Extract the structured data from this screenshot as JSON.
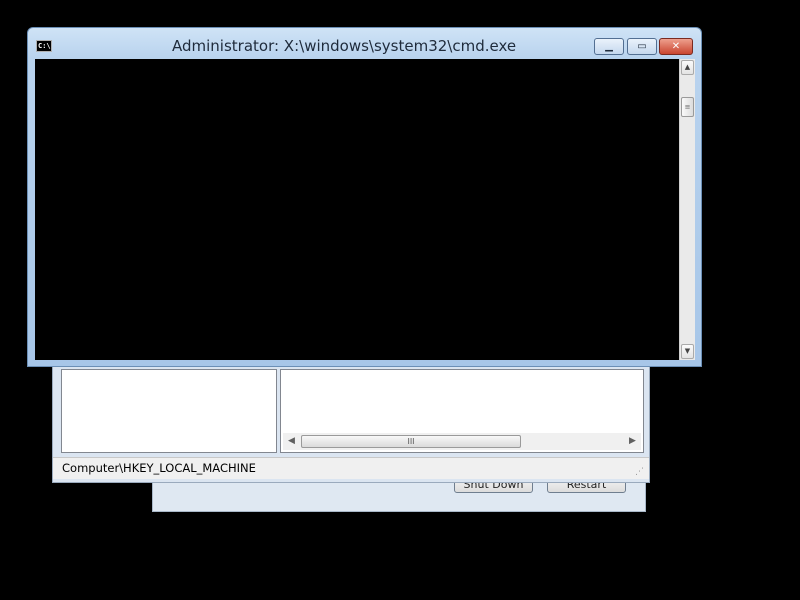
{
  "setup_dialog": {
    "shutdown_label": "Shut Down",
    "restart_label": "Restart"
  },
  "regedit": {
    "status_path": "Computer\\HKEY_LOCAL_MACHINE",
    "hscroll": {
      "left_icon": "scroll-left-arrow",
      "right_icon": "scroll-right-arrow",
      "thumb_grip": "III"
    }
  },
  "cmd": {
    "title": "Administrator: X:\\windows\\system32\\cmd.exe",
    "icon_text": "C:\\",
    "minimize_glyph": "▁",
    "maximize_glyph": "▭",
    "close_glyph": "✕",
    "console_text": ""
  }
}
